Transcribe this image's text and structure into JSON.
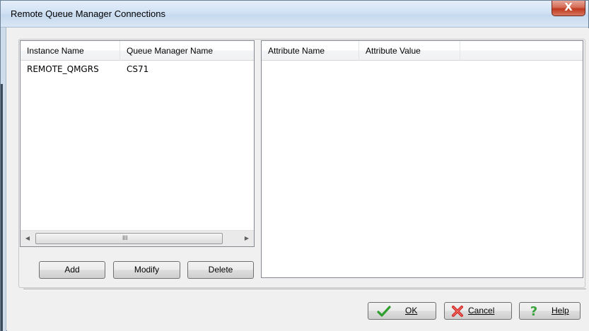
{
  "window": {
    "title": "Remote Queue Manager Connections",
    "close_glyph": "X"
  },
  "instances_list": {
    "columns": [
      "Instance Name",
      "Queue Manager Name"
    ],
    "rows": [
      {
        "instance_name": "REMOTE_QMGRS",
        "queue_manager_name": "CS71"
      }
    ],
    "scroll_grip": "III"
  },
  "attributes_list": {
    "columns": [
      "Attribute Name",
      "Attribute Value"
    ],
    "rows": []
  },
  "list_buttons": {
    "add": "Add",
    "modify": "Modify",
    "delete": "Delete"
  },
  "dialog_buttons": {
    "ok": "OK",
    "cancel": "Cancel",
    "help": "Help"
  },
  "icons": {
    "close": "close-icon",
    "ok": "checkmark-icon",
    "cancel": "red-x-icon",
    "help": "question-mark-icon",
    "scroll_left": "scroll-left-arrow-icon",
    "scroll_right": "scroll-right-arrow-icon"
  },
  "colors": {
    "ok_icon": "#2e9e2e",
    "cancel_icon": "#d42a2a",
    "help_icon": "#3aa33a",
    "close_button": "#c0391f"
  }
}
